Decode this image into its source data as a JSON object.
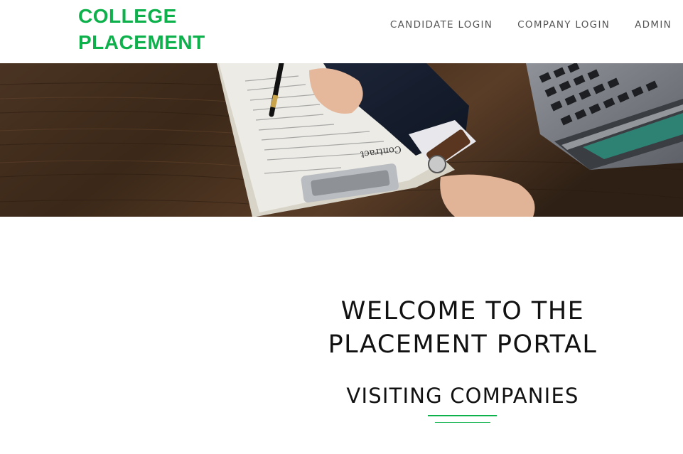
{
  "brand": {
    "line1": "COLLEGE",
    "line2": "PLACEMENT",
    "color": "#0db14b"
  },
  "nav": {
    "candidate_login": "CANDIDATE LOGIN",
    "company_login": "COMPANY LOGIN",
    "admin": "ADMIN"
  },
  "hero": {
    "image": "handshake-over-contract-photo",
    "contract_text": "Contract"
  },
  "welcome": {
    "line1": "WELCOME TO THE",
    "line2": "PLACEMENT PORTAL"
  },
  "section": {
    "title": "VISITING COMPANIES"
  }
}
